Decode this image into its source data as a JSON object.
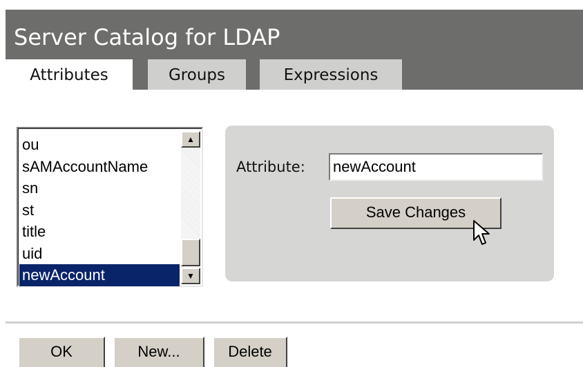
{
  "header": {
    "title": "Server Catalog for LDAP",
    "tabs": [
      {
        "label": "Attributes",
        "active": true
      },
      {
        "label": "Groups",
        "active": false
      },
      {
        "label": "Expressions",
        "active": false
      }
    ]
  },
  "attribute_list": {
    "items": [
      "ou",
      "sAMAccountName",
      "sn",
      "st",
      "title",
      "uid",
      "newAccount"
    ],
    "selected": "newAccount"
  },
  "editor": {
    "attribute_label": "Attribute:",
    "attribute_value": "newAccount",
    "save_label": "Save Changes"
  },
  "footer": {
    "ok_label": "OK",
    "new_label": "New...",
    "delete_label": "Delete"
  },
  "colors": {
    "header_bg": "#6d6d6b",
    "inactive_tab_bg": "#cfcfcd",
    "panel_bg": "#d6d6d4",
    "selection_bg": "#0a246a"
  }
}
